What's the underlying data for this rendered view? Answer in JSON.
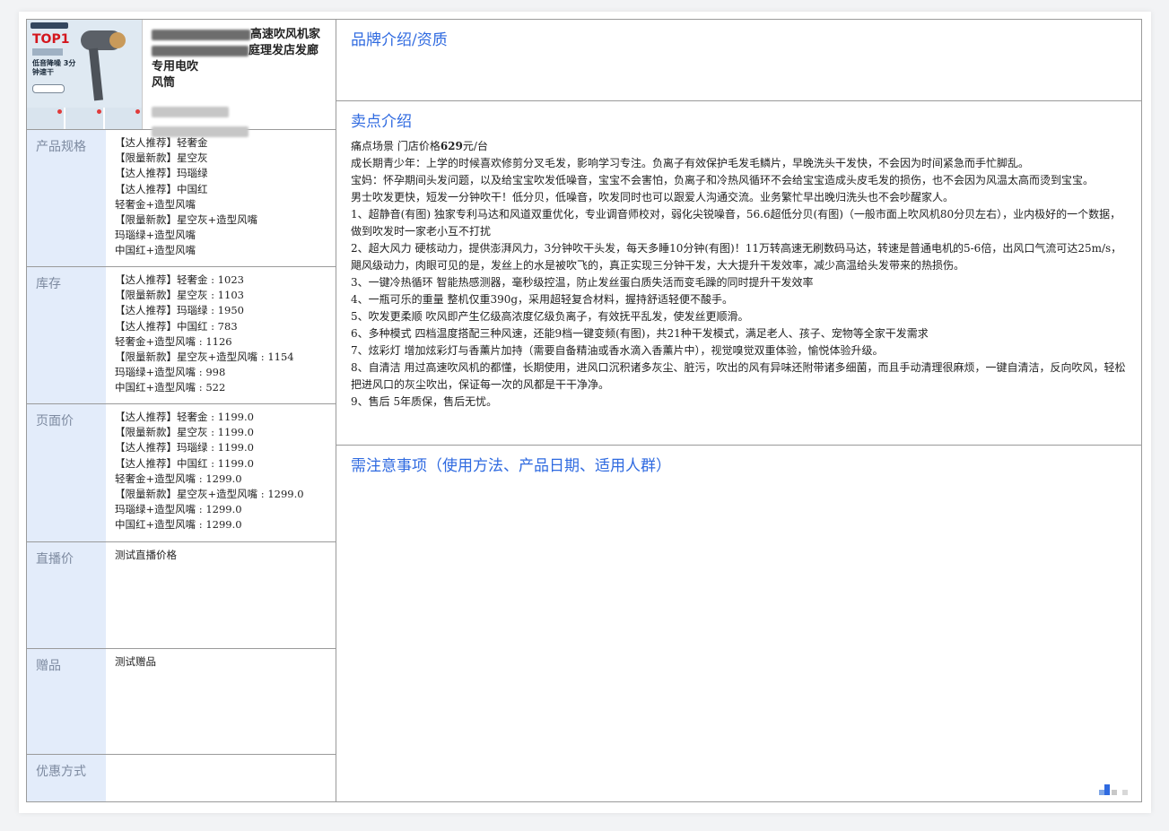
{
  "product": {
    "title_visible_1": "高速吹风机家",
    "title_visible_2": "庭理发店发廊专用电吹",
    "title_visible_3": "风筒",
    "thumb_badge": "TOP1",
    "thumb_caption": "低音降噪 3分钟速干"
  },
  "specs": [
    {
      "label": "产品规格",
      "items": [
        "【达人推荐】轻奢金",
        "【限量新款】星空灰",
        "【达人推荐】玛瑙绿",
        "【达人推荐】中国红",
        "轻奢金+造型风嘴",
        "【限量新款】星空灰+造型风嘴",
        "玛瑙绿+造型风嘴",
        "中国红+造型风嘴"
      ]
    },
    {
      "label": "库存",
      "items": [
        "【达人推荐】轻奢金 : 1023",
        "【限量新款】星空灰 : 1103",
        "【达人推荐】玛瑙绿 : 1950",
        "【达人推荐】中国红 : 783",
        "轻奢金+造型风嘴 : 1126",
        "【限量新款】星空灰+造型风嘴 : 1154",
        "玛瑙绿+造型风嘴 : 998",
        "中国红+造型风嘴 : 522"
      ]
    },
    {
      "label": "页面价",
      "items": [
        "【达人推荐】轻奢金 : 1199.0",
        "【限量新款】星空灰 : 1199.0",
        "【达人推荐】玛瑙绿 : 1199.0",
        "【达人推荐】中国红 : 1199.0",
        "轻奢金+造型风嘴 : 1299.0",
        "【限量新款】星空灰+造型风嘴 : 1299.0",
        "玛瑙绿+造型风嘴 : 1299.0",
        "中国红+造型风嘴 : 1299.0"
      ]
    },
    {
      "label": "直播价",
      "items": [
        "测试直播价格"
      ]
    },
    {
      "label": "赠品",
      "items": [
        "测试赠品"
      ]
    },
    {
      "label": "优惠方式",
      "items": []
    }
  ],
  "sections": {
    "brand_title": "品牌介绍/资质",
    "selling_title": "卖点介绍",
    "notes_title": "需注意事项（使用方法、产品日期、适用人群）"
  },
  "selling_points": {
    "pain_prefix": "痛点场景 门店价格",
    "pain_price": "629",
    "pain_suffix": "元/台",
    "lines": [
      "成长期青少年：上学的时候喜欢修剪分叉毛发，影响学习专注。负离子有效保护毛发毛鳞片，早晚洗头干发快，不会因为时间紧急而手忙脚乱。",
      "宝妈：怀孕期间头发问题，以及给宝宝吹发低噪音，宝宝不会害怕，负离子和冷热风循环不会给宝宝造成头皮毛发的损伤，也不会因为风温太高而烫到宝宝。",
      "男士吹发更快，短发一分钟吹干！低分贝，低噪音，吹发同时也可以跟爱人沟通交流。业务繁忙早出晚归洗头也不会吵醒家人。",
      "1、超静音(有图) 独家专利马达和风道双重优化，专业调音师校对，弱化尖锐噪音，56.6超低分贝(有图)（一般市面上吹风机80分贝左右），业内极好的一个数据，做到吹发时一家老小互不打扰",
      "2、超大风力 硬核动力，提供澎湃风力，3分钟吹干头发，每天多睡10分钟(有图)！11万转高速无刷数码马达，转速是普通电机的5-6倍，出风口气流可达25m/s，飓风级动力，肉眼可见的是，发丝上的水是被吹飞的，真正实现三分钟干发，大大提升干发效率，减少高温给头发带来的热损伤。",
      "3、一键冷热循环 智能热感测器，毫秒级控温，防止发丝蛋白质失活而变毛躁的同时提升干发效率",
      "4、一瓶可乐的重量 整机仅重390g，采用超轻复合材料，握持舒适轻便不酸手。",
      "5、吹发更柔顺 吹风即产生亿级高浓度亿级负离子，有效抚平乱发，使发丝更顺滑。",
      "6、多种模式 四档温度搭配三种风速，还能9档一键变频(有图)，共21种干发模式，满足老人、孩子、宠物等全家干发需求",
      "7、炫彩灯 增加炫彩灯与香薰片加持（需要自备精油或香水滴入香薰片中），视觉嗅觉双重体验，愉悦体验升级。",
      "8、自清洁 用过高速吹风机的都懂，长期使用，进风口沉积诸多灰尘、脏污，吹出的风有异味还附带诸多细菌，而且手动清理很麻烦，一键自清洁，反向吹风，轻松把进风口的灰尘吹出，保证每一次的风都是干干净净。",
      "9、售后 5年质保，售后无忧。"
    ]
  },
  "colors": {
    "accent": "#2f6ae0",
    "label_bg": "#e3ecfa",
    "label_text": "#7d8aa0"
  }
}
